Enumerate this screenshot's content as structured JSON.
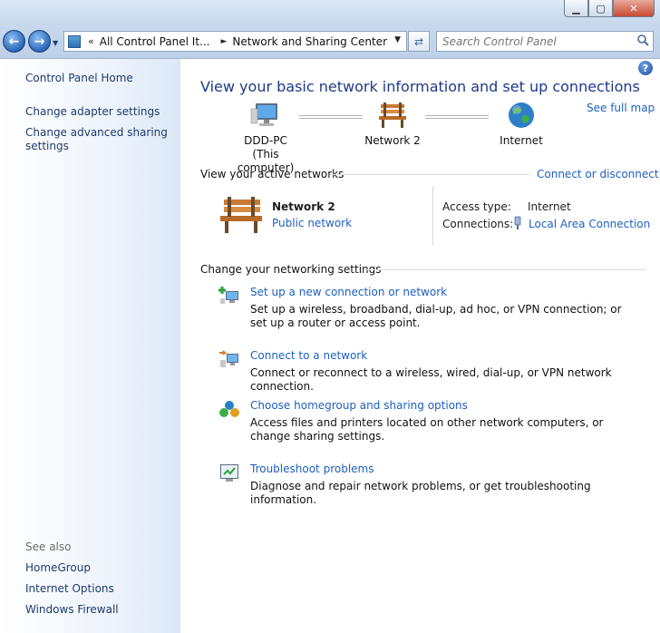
{
  "window": {
    "controls": {
      "minimize": "▁",
      "maximize": "▢",
      "close": "✕"
    }
  },
  "navbar": {
    "back_icon": "back-arrow-icon",
    "forward_icon": "forward-arrow-icon",
    "address": {
      "chevrons": "«",
      "segments": [
        "All Control Panel It...",
        "Network and Sharing Center"
      ],
      "separator": "►"
    },
    "search": {
      "placeholder": "Search Control Panel"
    }
  },
  "sidebar": {
    "items": [
      {
        "label": "Control Panel Home"
      },
      {
        "label": "Change adapter settings"
      },
      {
        "label": "Change advanced sharing settings"
      }
    ],
    "see_also": {
      "label": "See also",
      "items": [
        {
          "label": "HomeGroup"
        },
        {
          "label": "Internet Options"
        },
        {
          "label": "Windows Firewall"
        }
      ]
    }
  },
  "main": {
    "title": "View your basic network information and set up connections",
    "see_full_map": "See full map",
    "map": {
      "computer": {
        "name": "DDD-PC",
        "sub": "(This computer)"
      },
      "network": {
        "name": "Network  2"
      },
      "internet": {
        "name": "Internet"
      }
    },
    "active_networks": {
      "heading": "View your active networks",
      "connect_link": "Connect or disconnect",
      "network_name": "Network  2",
      "network_type": "Public network",
      "access_type_label": "Access type:",
      "access_type_value": "Internet",
      "connections_label": "Connections:",
      "connections_value": "Local Area Connection"
    },
    "settings": {
      "heading": "Change your networking settings",
      "tasks": [
        {
          "link": "Set up a new connection or network",
          "desc": "Set up a wireless, broadband, dial-up, ad hoc, or VPN connection; or set up a router or access point.",
          "icon": "new-connection-icon"
        },
        {
          "link": "Connect to a network",
          "desc": "Connect or reconnect to a wireless, wired, dial-up, or VPN network connection.",
          "icon": "connect-network-icon"
        },
        {
          "link": "Choose homegroup and sharing options",
          "desc": "Access files and printers located on other network computers, or change sharing settings.",
          "icon": "homegroup-icon"
        },
        {
          "link": "Troubleshoot problems",
          "desc": "Diagnose and repair network problems, or get troubleshooting information.",
          "icon": "troubleshoot-icon"
        }
      ]
    }
  }
}
